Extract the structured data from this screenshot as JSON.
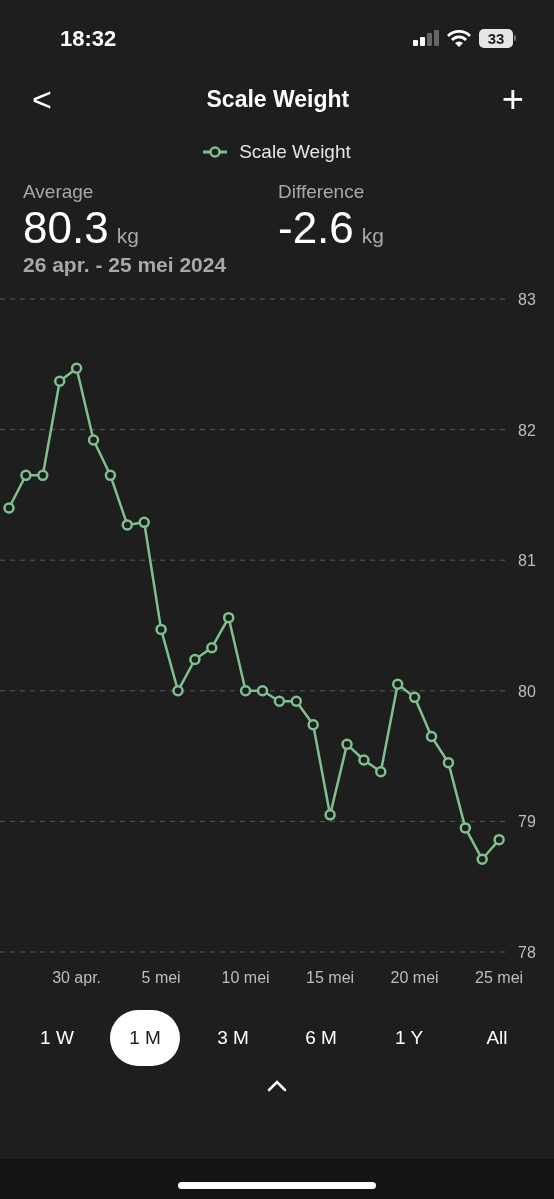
{
  "status_bar": {
    "time": "18:32",
    "battery": "33"
  },
  "header": {
    "back": "<",
    "title": "Scale Weight",
    "add": "+"
  },
  "stats": [
    {
      "label": "Average",
      "value": "80.3",
      "unit": "kg"
    },
    {
      "label": "Difference",
      "value": "-2.6",
      "unit": "kg"
    }
  ],
  "period": "26 apr. - 25 mei 2024",
  "chart": {
    "chart_data": {
      "type": "line",
      "categories": [
        null,
        null,
        null,
        null,
        "30 apr.",
        null,
        null,
        null,
        null,
        "5 mei",
        null,
        null,
        null,
        null,
        "10 mei",
        null,
        null,
        null,
        null,
        "15 mei",
        null,
        null,
        null,
        null,
        "20 mei",
        null,
        null,
        null,
        null,
        "25 mei"
      ],
      "grid": true,
      "series": [
        {
          "name": "Scale Weight",
          "color": "#7fc08f",
          "marker": "circle",
          "values": [
            81.4,
            81.65,
            81.65,
            82.37,
            82.47,
            81.92,
            81.65,
            81.27,
            81.29,
            80.47,
            80.0,
            80.24,
            80.33,
            80.56,
            80.0,
            80.0,
            79.92,
            79.92,
            79.74,
            79.05,
            79.59,
            79.47,
            79.38,
            80.05,
            79.95,
            79.65,
            79.45,
            78.95,
            78.71,
            78.86
          ]
        }
      ],
      "ylim": [
        78,
        83
      ],
      "yticks": [
        78,
        79,
        80,
        81,
        82,
        83
      ]
    }
  },
  "ranges": [
    {
      "label": "1 W",
      "selected": false
    },
    {
      "label": "1 M",
      "selected": true
    },
    {
      "label": "3 M",
      "selected": false
    },
    {
      "label": "6 M",
      "selected": false
    },
    {
      "label": "1 Y",
      "selected": false
    },
    {
      "label": "All",
      "selected": false
    }
  ]
}
